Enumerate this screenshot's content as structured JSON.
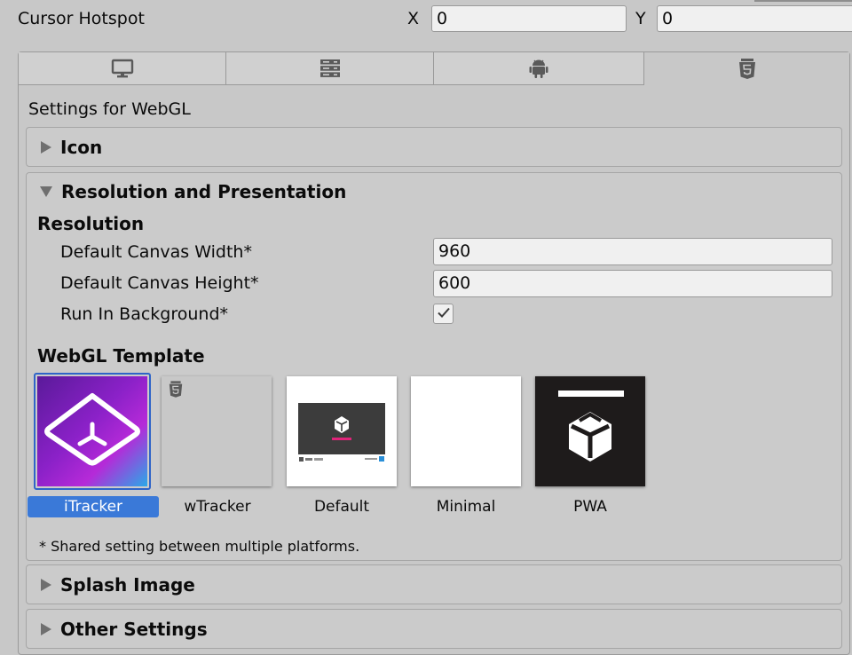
{
  "cursor_hotspot": {
    "label": "Cursor Hotspot",
    "x_label": "X",
    "x_value": "0",
    "y_label": "Y",
    "y_value": "0"
  },
  "platform_tabs": [
    {
      "icon": "monitor-icon",
      "active": false
    },
    {
      "icon": "server-icon",
      "active": false
    },
    {
      "icon": "android-icon",
      "active": false
    },
    {
      "icon": "html5-icon",
      "active": true
    }
  ],
  "settings_title": "Settings for WebGL",
  "sections": {
    "icon": {
      "title": "Icon",
      "expanded": false
    },
    "resolution": {
      "title": "Resolution and Presentation",
      "expanded": true,
      "subheading": "Resolution",
      "canvas_width_label": "Default Canvas Width*",
      "canvas_width_value": "960",
      "canvas_height_label": "Default Canvas Height*",
      "canvas_height_value": "600",
      "run_in_background_label": "Run In Background*",
      "run_in_background_checked": true,
      "template_heading": "WebGL Template",
      "templates": [
        {
          "name": "iTracker",
          "selected": true
        },
        {
          "name": "wTracker",
          "selected": false
        },
        {
          "name": "Default",
          "selected": false
        },
        {
          "name": "Minimal",
          "selected": false
        },
        {
          "name": "PWA",
          "selected": false
        }
      ],
      "footnote": "* Shared setting between multiple platforms."
    },
    "splash": {
      "title": "Splash Image",
      "expanded": false
    },
    "other": {
      "title": "Other Settings",
      "expanded": false
    }
  },
  "colors": {
    "selected_blue": "#3a79d8",
    "panel_gray": "#c8c8c8",
    "field_bg": "#f0f0f0"
  }
}
